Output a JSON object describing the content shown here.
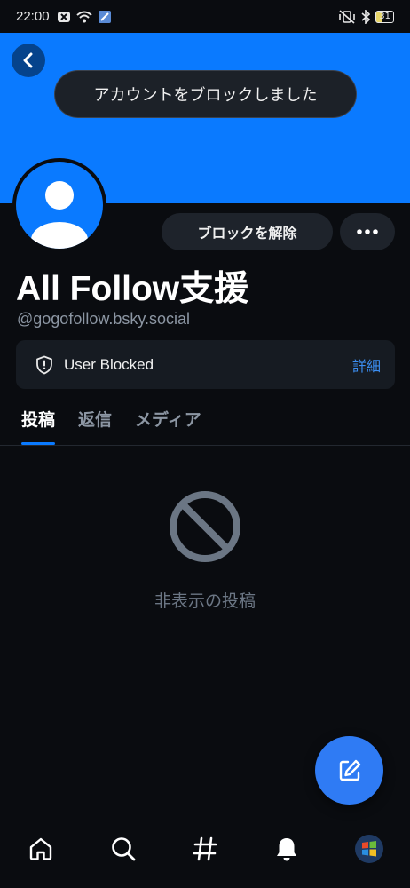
{
  "status_bar": {
    "time": "22:00",
    "battery": "31"
  },
  "toast": {
    "message": "アカウントをブロックしました"
  },
  "profile": {
    "display_name": "All Follow支援",
    "handle": "@gogofollow.bsky.social",
    "unblock_label": "ブロックを解除",
    "banner_color": "#0a7aff"
  },
  "blocked_notice": {
    "label": "User Blocked",
    "details_label": "詳細"
  },
  "tabs": [
    {
      "label": "投稿",
      "active": true
    },
    {
      "label": "返信",
      "active": false
    },
    {
      "label": "メディア",
      "active": false
    }
  ],
  "empty_state": {
    "message": "非表示の投稿"
  },
  "bottom_nav": [
    "home-icon",
    "search-icon",
    "feeds-hash-icon",
    "notifications-bell-icon",
    "profile-avatar"
  ],
  "colors": {
    "accent": "#0a7aff",
    "background": "#0a0c10"
  }
}
